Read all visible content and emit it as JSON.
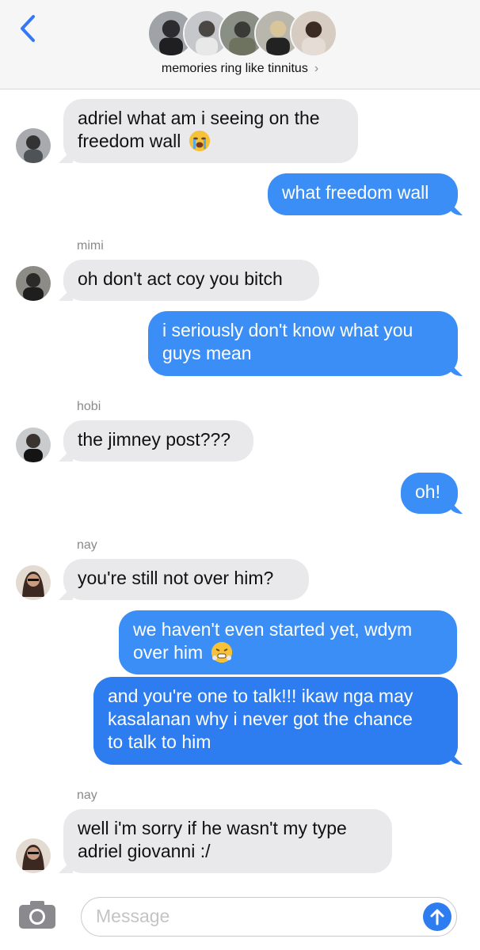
{
  "header": {
    "group_name": "memories ring like tinnitus",
    "chevron": "›",
    "back_icon": "chevron-left-icon",
    "accent": "#3478f6"
  },
  "messages": [
    {
      "from": "other",
      "text_line1": "adriel what am i seeing on the",
      "text_line2": "freedom wall",
      "emoji": "loudly-crying-face"
    },
    {
      "from": "me",
      "text": "what freedom wall"
    },
    {
      "from": "other",
      "sender": "mimi",
      "text": "oh don't act coy you bitch"
    },
    {
      "from": "me",
      "text_line1": "i seriously don't know what you",
      "text_line2": "guys mean"
    },
    {
      "from": "other",
      "sender": "hobi",
      "text": "the jimney post???"
    },
    {
      "from": "me",
      "text": "oh!"
    },
    {
      "from": "other",
      "sender": "nay",
      "text": "you're still not over him?"
    },
    {
      "from": "me",
      "text_line1": "we haven't even started yet, wdym",
      "text_line2": "over him",
      "emoji": "face-with-steam"
    },
    {
      "from": "me",
      "text_line1": "and you're one to talk!!! ikaw nga may",
      "text_line2": "kasalanan why i never got the chance",
      "text_line3": "to talk to him"
    },
    {
      "from": "other",
      "sender": "nay",
      "text_line1": "well i'm sorry if he wasn't my type",
      "text_line2": "adriel giovanni :/"
    }
  ],
  "composer": {
    "placeholder": "Message",
    "camera_icon": "camera-icon",
    "send_icon": "arrow-up-icon"
  },
  "colors": {
    "sent_bubble": "#3b8ef5",
    "received_bubble": "#e9e9eb",
    "header_bg": "#f6f6f6"
  }
}
